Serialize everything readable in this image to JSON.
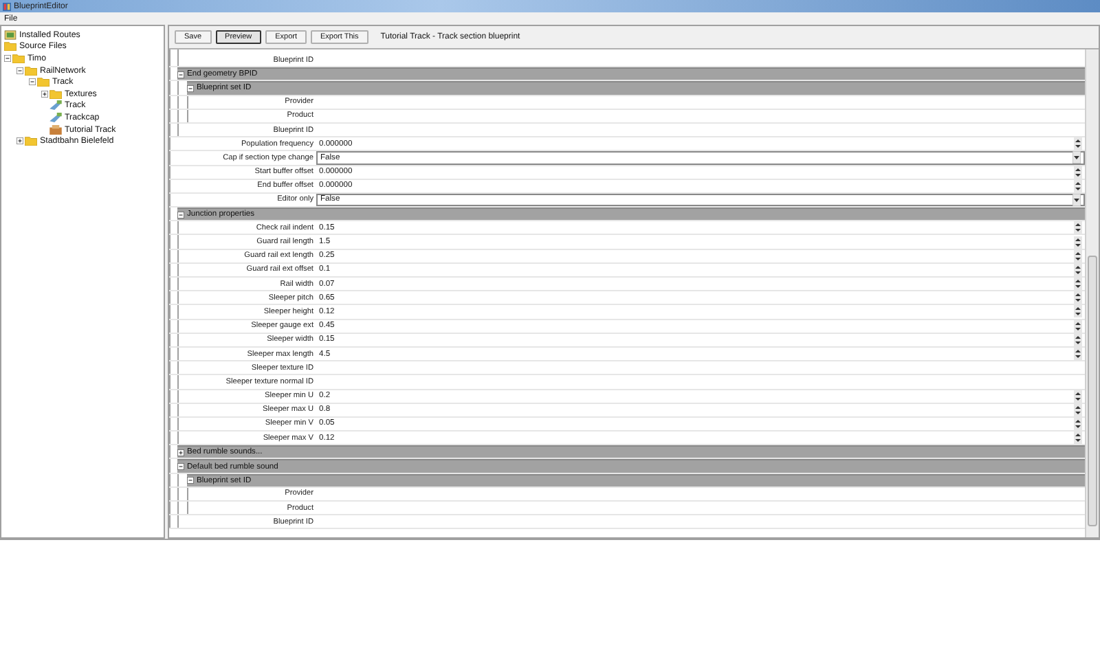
{
  "window": {
    "title": "BlueprintEditor"
  },
  "menu": [
    "File"
  ],
  "tree": [
    {
      "label": "Installed Routes",
      "kind": "routes"
    },
    {
      "label": "Source Files",
      "kind": "folder"
    },
    {
      "label": "Timo",
      "kind": "folder",
      "expanded": true,
      "children": [
        {
          "label": "RailNetwork",
          "kind": "folder",
          "expanded": true,
          "children": [
            {
              "label": "Track",
              "kind": "folder",
              "expanded": true,
              "children": [
                {
                  "label": "Textures",
                  "kind": "folder",
                  "expanded": false
                },
                {
                  "label": "Track",
                  "kind": "track"
                },
                {
                  "label": "Trackcap",
                  "kind": "track"
                },
                {
                  "label": "Tutorial Track",
                  "kind": "tutorial"
                }
              ]
            }
          ]
        },
        {
          "label": "Stadtbahn Bielefeld",
          "kind": "folder",
          "expanded": false
        }
      ]
    }
  ],
  "toolbar": {
    "buttons": [
      {
        "label": "Save",
        "selected": false
      },
      {
        "label": "Preview",
        "selected": true
      },
      {
        "label": "Export",
        "selected": false
      },
      {
        "label": "Export This",
        "selected": false
      }
    ],
    "caption": "Tutorial Track - Track section blueprint"
  },
  "grid": [
    {
      "kind": "group",
      "children": [
        {
          "kind": "text",
          "label": "Blueprint ID"
        }
      ]
    },
    {
      "kind": "section",
      "label": "End geometry BPID",
      "expanded": true,
      "children": [
        {
          "kind": "section",
          "label": "Blueprint set ID",
          "expanded": true,
          "children": [
            {
              "kind": "text",
              "label": "Provider"
            },
            {
              "kind": "text",
              "label": "Product"
            }
          ]
        },
        {
          "kind": "text",
          "label": "Blueprint ID"
        }
      ]
    },
    {
      "kind": "spin",
      "label": "Population frequency",
      "value": "0.000000"
    },
    {
      "kind": "dropdown",
      "label": "Cap if section type change",
      "value": "False"
    },
    {
      "kind": "spin",
      "label": "Start buffer offset",
      "value": "0.000000"
    },
    {
      "kind": "spin",
      "label": "End buffer offset",
      "value": "0.000000"
    },
    {
      "kind": "dropdown",
      "label": "Editor only",
      "value": "False"
    },
    {
      "kind": "section",
      "label": "Junction properties",
      "expanded": true,
      "children": [
        {
          "kind": "spin",
          "label": "Check rail indent",
          "value": "0.15"
        },
        {
          "kind": "spin",
          "label": "Guard rail length",
          "value": "1.5"
        },
        {
          "kind": "spin",
          "label": "Guard rail ext length",
          "value": "0.25"
        },
        {
          "kind": "spin",
          "label": "Guard rail ext offset",
          "value": "0.1"
        },
        {
          "kind": "spin",
          "label": "Rail width",
          "value": "0.07"
        },
        {
          "kind": "spin",
          "label": "Sleeper pitch",
          "value": "0.65"
        },
        {
          "kind": "spin",
          "label": "Sleeper height",
          "value": "0.12"
        },
        {
          "kind": "spin",
          "label": "Sleeper gauge ext",
          "value": "0.45"
        },
        {
          "kind": "spin",
          "label": "Sleeper width",
          "value": "0.15"
        },
        {
          "kind": "spin",
          "label": "Sleeper max length",
          "value": "4.5"
        },
        {
          "kind": "text",
          "label": "Sleeper texture ID"
        },
        {
          "kind": "text",
          "label": "Sleeper texture normal ID"
        },
        {
          "kind": "spin",
          "label": "Sleeper min U",
          "value": "0.2"
        },
        {
          "kind": "spin",
          "label": "Sleeper max U",
          "value": "0.8"
        },
        {
          "kind": "spin",
          "label": "Sleeper min V",
          "value": "0.05"
        },
        {
          "kind": "spin",
          "label": "Sleeper max V",
          "value": "0.12"
        }
      ]
    },
    {
      "kind": "section",
      "label": "Bed rumble sounds...",
      "expanded": false
    },
    {
      "kind": "section",
      "label": "Default bed rumble sound",
      "expanded": true,
      "children": [
        {
          "kind": "section",
          "label": "Blueprint set ID",
          "expanded": true,
          "children": [
            {
              "kind": "text",
              "label": "Provider"
            },
            {
              "kind": "text",
              "label": "Product"
            }
          ]
        },
        {
          "kind": "text",
          "label": "Blueprint ID"
        }
      ]
    }
  ]
}
